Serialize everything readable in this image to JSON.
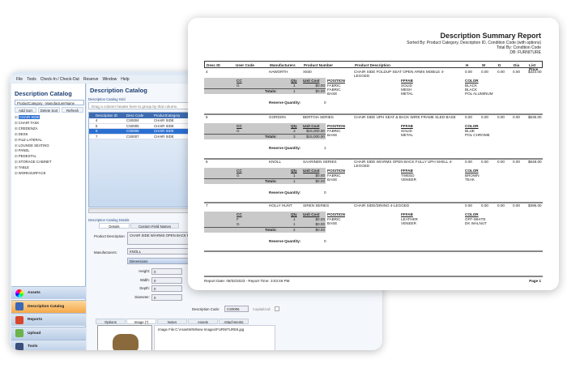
{
  "app": {
    "menu": [
      "File",
      "Tools",
      "Check-In / Check-Out",
      "Reserve",
      "Window",
      "Help"
    ],
    "left_title": "Description Catalog",
    "sort_select": "ProductCategory - ManufacturerName",
    "buttons": {
      "add_sort": "Add Sort",
      "delete_sort": "Delete Sort",
      "refresh": "Refresh"
    },
    "tree": [
      "CHAIR SIDE",
      "CHAIR TASK",
      "CREDENZA",
      "DESK",
      "FILE LATERAL",
      "LOUNGE SEATING",
      "PANEL",
      "PEDESTAL",
      "STORAGE CABINET",
      "TABLE",
      "WORKSURFACE"
    ],
    "nav": [
      "Assets",
      "Description Catalog",
      "Reports",
      "Upload",
      "Tools"
    ],
    "main_title": "Description Catalog",
    "grid_label": "Description Catalog Grid",
    "drag_hint": "Drag a column header here to group by that column.",
    "grid_headers": [
      "Description ID",
      "Desc Code",
      "ProductCategory"
    ],
    "grid_rows": [
      [
        "4",
        "CS0004",
        "CHAIR SIDE"
      ],
      [
        "5",
        "CS0005",
        "CHAIR SIDE"
      ],
      [
        "6",
        "CS0006",
        "CHAIR SIDE"
      ],
      [
        "7",
        "CS0007",
        "CHAIR SIDE"
      ]
    ],
    "details_label": "Description Catalog Details",
    "detail_tabs": [
      "Details",
      "Custom Field Names"
    ],
    "product_description_label": "Product Description:",
    "product_description": "CHAIR SIDE W/ARMS OPEN BACK FUL",
    "manufacturers_label": "Manufacturers:",
    "manufacturer": "KNOLL",
    "dimensions_label": "Dimensions",
    "dims": [
      {
        "label": "Height:",
        "value": "0"
      },
      {
        "label": "Width:",
        "value": "0"
      },
      {
        "label": "Depth:",
        "value": "0"
      },
      {
        "label": "Diameter:",
        "value": "0"
      }
    ],
    "desc_code_label": "Description Code:",
    "desc_code": "CS0006",
    "capitalized_label": "Capitalized:",
    "bottom_tabs": [
      "Options",
      "Image (*)",
      "Notes",
      "Assets",
      "Attachments"
    ],
    "image_file": "Image File:C:\\AssetWIN\\New Images\\FURNITURE6.jpg"
  },
  "report": {
    "title": "Description Summary Report",
    "sorted_by": "Sorted By: Product Category, Description ID, Condition Code (with options)",
    "total_by": "Total By: Condition Code",
    "db": "DB: FURNITURE",
    "headers": [
      "Desc ID",
      "User Code",
      "Manufacturers",
      "Product Number",
      "Product Description",
      "H",
      "W",
      "D",
      "Dia",
      "List Price"
    ],
    "sub_headers": {
      "cc": "CC",
      "qty": "Qty",
      "unit_cost": "Unit Cost",
      "position": "POSITION",
      "fffab": "FFFAB",
      "color": "COLOR",
      "totals": "Totals:",
      "reserve": "Reserve Quantity:"
    },
    "entries": [
      {
        "id": "4",
        "user": "",
        "mfr": "HAWORTH",
        "num": "X840",
        "desc": "CHAIR SIDE FOLDUP SEAT OPEN ARMS MOBILE 4-LEGGED",
        "h": "0.00",
        "w": "0.00",
        "d": "0.00",
        "dia": "0.00",
        "price": "$324.00",
        "cc": [
          {
            "cc": "G",
            "qty": "1",
            "cost": "$0.00"
          }
        ],
        "total_qty": "1",
        "total_cost": "$0.00",
        "options": [
          [
            "FABRIC",
            "SOLID",
            "BLACK"
          ],
          [
            "FABRIC",
            "MESH",
            "BLACK"
          ],
          [
            "BASE",
            "METAL",
            "POL ALUMINUM"
          ]
        ],
        "reserve": "0"
      },
      {
        "id": "5",
        "user": "",
        "mfr": "GORDON",
        "num": "BERTOIA SERIES",
        "desc": "CHAIR SIDE UPH SEAT & BACK WIRE FRAME SLED BASE",
        "h": "0.00",
        "w": "0.00",
        "d": "0.00",
        "dia": "0.00",
        "price": "$636.00",
        "cc": [
          {
            "cc": "G",
            "qty": "3",
            "cost": "$15,000.00"
          }
        ],
        "total_qty": "3",
        "total_cost": "$15,000.00",
        "options": [
          [
            "FABRIC",
            "SOLID",
            "BLUE"
          ],
          [
            "BASE",
            "METAL",
            "POL CHROME"
          ]
        ],
        "reserve": "1"
      },
      {
        "id": "6",
        "user": "",
        "mfr": "KNOLL",
        "num": "SAARINEN SERIES",
        "desc": "CHAIR SIDE W/ARMS OPEN BACK FULLY UPH SHELL 4-LEGGED",
        "h": "0.00",
        "w": "0.00",
        "d": "0.00",
        "dia": "0.00",
        "price": "$648.00",
        "cc": [
          {
            "cc": "G",
            "qty": "1",
            "cost": "$0.00"
          }
        ],
        "total_qty": "1",
        "total_cost": "$0.00",
        "options": [
          [
            "FABRIC",
            "TWEED",
            "BROWN"
          ],
          [
            "BASE",
            "VENEER",
            "TEAK"
          ]
        ],
        "reserve": "0"
      },
      {
        "id": "7",
        "user": "",
        "mfr": "HOLLY HUNT",
        "num": "SIREN SERIES",
        "desc": "CHAIR SIDE/DINING 4-LEGGED",
        "h": "0.00",
        "w": "0.00",
        "d": "0.00",
        "dia": "0.00",
        "price": "$396.00",
        "cc": [
          {
            "cc": "F",
            "qty": "1",
            "cost": "$0.00"
          },
          {
            "cc": "G",
            "qty": "1",
            "cost": "$0.00"
          }
        ],
        "total_qty": "2",
        "total_cost": "$0.00",
        "options": [
          [
            "FABRIC",
            "LEATHER",
            "OFF-WHITE"
          ],
          [
            "BASE",
            "VENEER",
            "DK WALNUT"
          ]
        ],
        "reserve": "0"
      }
    ],
    "footer": "Report Date: 06/02/2023 - Report Time: 3:03:46 PM",
    "page": "Page 1"
  }
}
